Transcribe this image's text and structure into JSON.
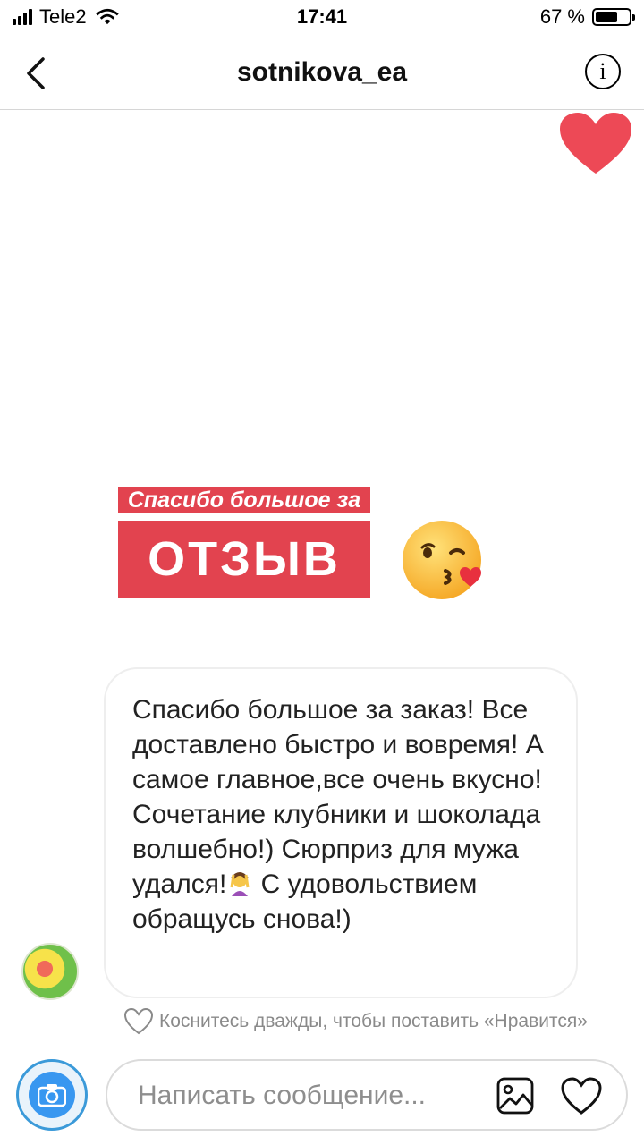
{
  "status_bar": {
    "carrier": "Tele2",
    "time": "17:41",
    "battery_text": "67 %",
    "battery_level": 0.67
  },
  "nav": {
    "title": "sotnikova_ea",
    "info_label": "i"
  },
  "sticker": {
    "top_text": "Спасибо большое за",
    "main_text": "ОТЗЫВ"
  },
  "message": {
    "text_part1": "Спасибо большое за заказ! Все доставлено быстро и вовремя! А самое главное,все очень вкусно! Сочетание клубники и шоколада волшебно!) Сюрприз для мужа удался!",
    "text_part2": " С удовольствием обращусь снова!)"
  },
  "like_hint": "Коснитесь дважды, чтобы поставить «Нравится»",
  "composer": {
    "placeholder": "Написать сообщение..."
  },
  "colors": {
    "accent_red": "#e2434f",
    "heart_red": "#ed4956",
    "camera_blue": "#3897f0"
  },
  "icons": [
    "back-chevron-icon",
    "info-icon",
    "heart-icon",
    "kiss-emoji-icon",
    "woman-gesture-emoji-icon",
    "camera-icon",
    "gallery-icon"
  ]
}
